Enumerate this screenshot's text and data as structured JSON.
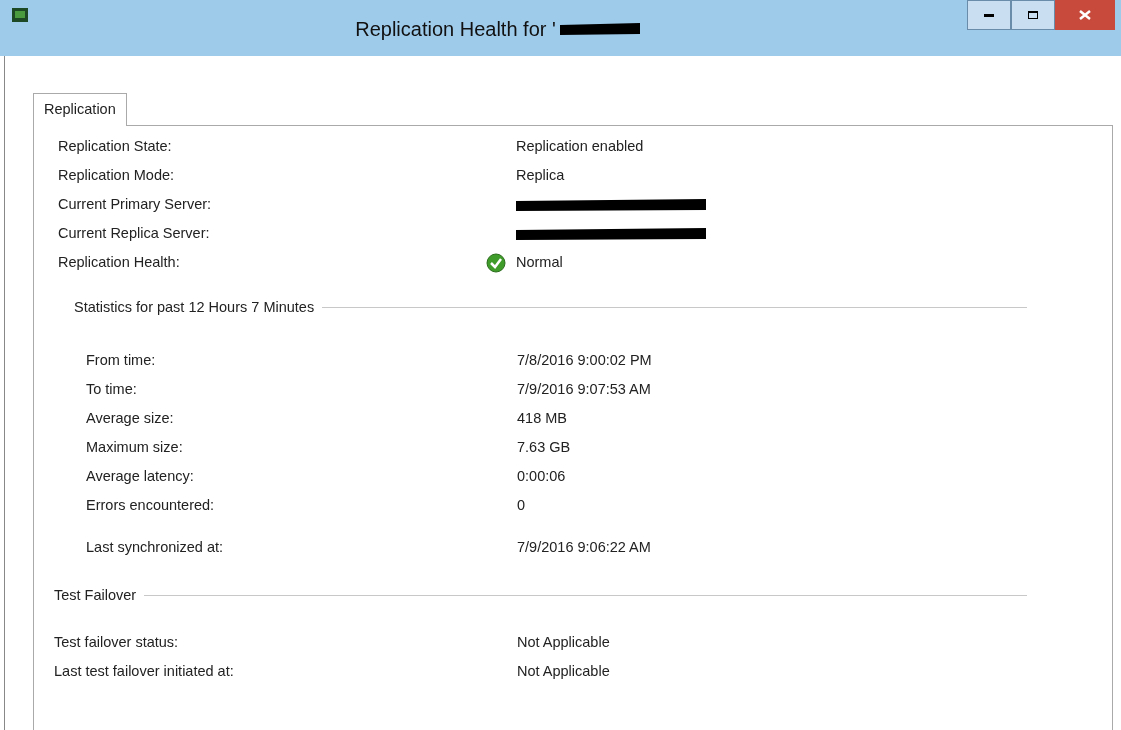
{
  "window": {
    "title": "Replication Health for '",
    "title_redacted": true
  },
  "tabs": [
    {
      "label": "Replication",
      "selected": true
    }
  ],
  "summary": [
    {
      "kind": "plain",
      "label": "Replication State:",
      "value": "Replication enabled"
    },
    {
      "kind": "plain",
      "label": "Replication Mode:",
      "value": "Replica"
    },
    {
      "kind": "redacted",
      "label": "Current Primary Server:"
    },
    {
      "kind": "redacted",
      "label": "Current Replica Server:"
    },
    {
      "kind": "health",
      "label": "Replication Health:",
      "value": "Normal"
    }
  ],
  "statistics": {
    "title": "Statistics for past 12 Hours 7 Minutes",
    "rows": [
      {
        "label": "From time:",
        "value": "7/8/2016 9:00:02 PM"
      },
      {
        "label": "To time:",
        "value": "7/9/2016 9:07:53 AM"
      },
      {
        "label": "Average size:",
        "value": "418 MB"
      },
      {
        "label": "Maximum size:",
        "value": "7.63 GB"
      },
      {
        "label": "Average latency:",
        "value": "0:00:06"
      },
      {
        "label": "Errors encountered:",
        "value": "0"
      }
    ],
    "last": {
      "label": "Last synchronized at:",
      "value": "7/9/2016 9:06:22 AM"
    }
  },
  "test_failover": {
    "title": "Test Failover",
    "rows": [
      {
        "label": "Test failover status:",
        "value": "Not Applicable"
      },
      {
        "label": "Last test failover initiated at:",
        "value": "Not Applicable"
      }
    ]
  }
}
